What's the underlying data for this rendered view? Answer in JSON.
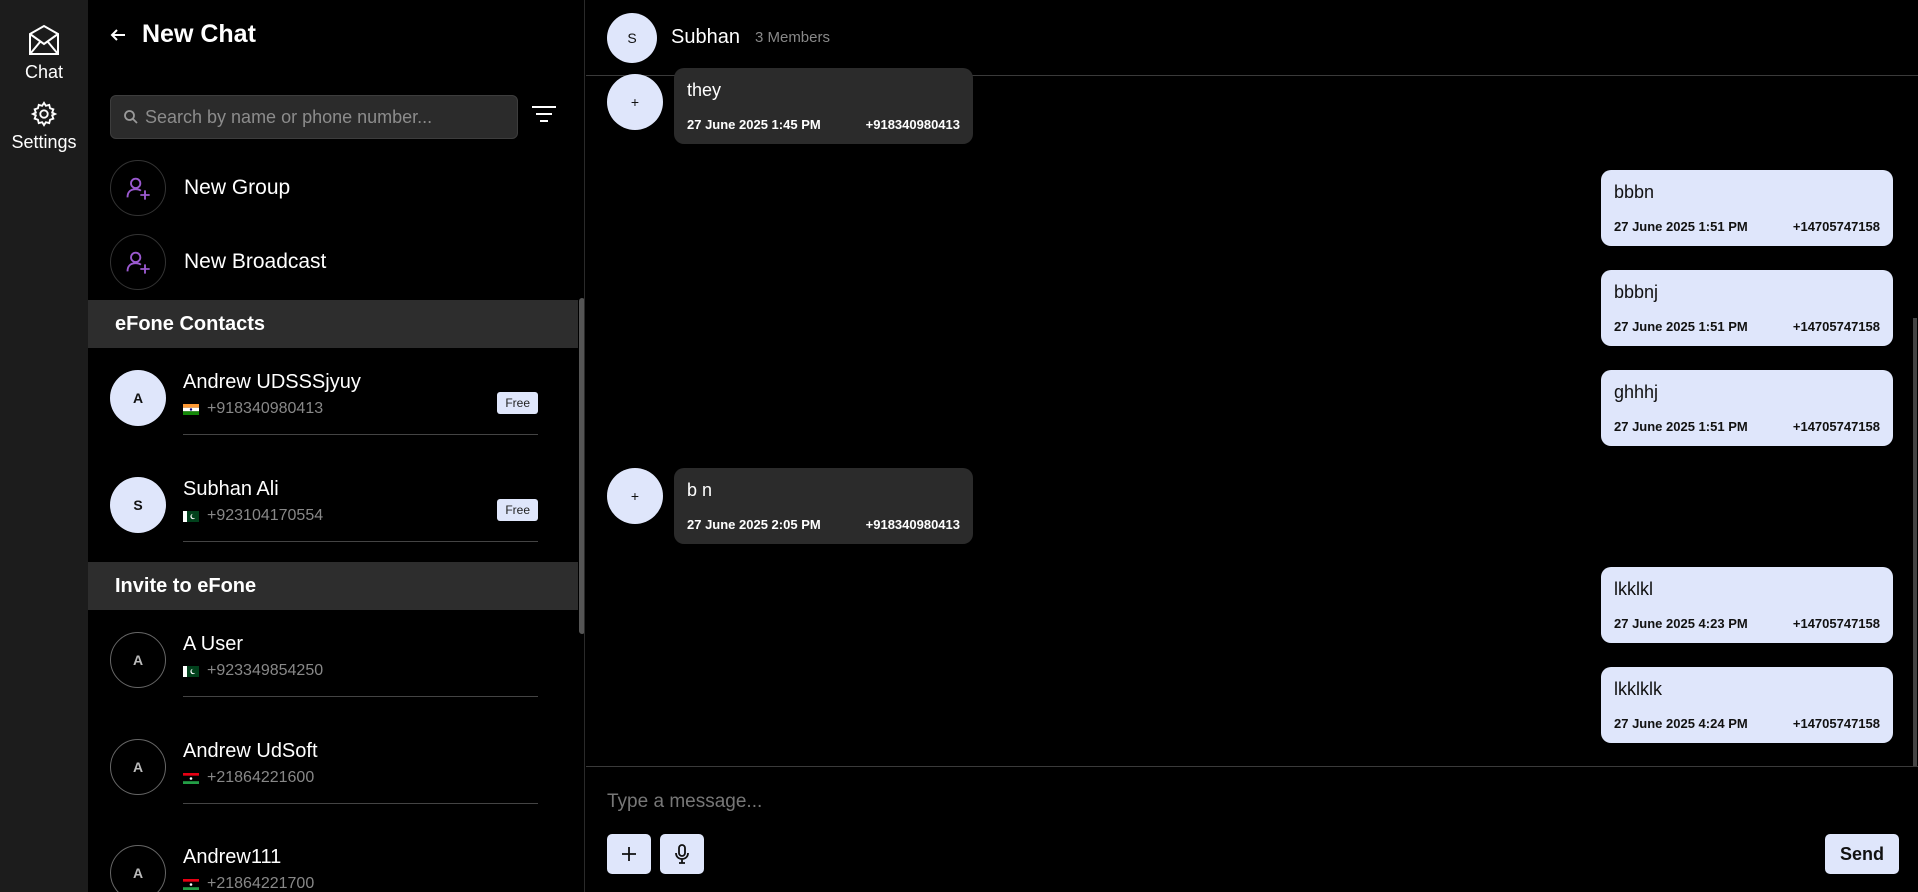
{
  "rail": {
    "chat_label": "Chat",
    "settings_label": "Settings"
  },
  "panel": {
    "title": "New Chat",
    "search_placeholder": "Search by name or phone number...",
    "actions": [
      {
        "label": "New Group",
        "icon": "add-user-icon"
      },
      {
        "label": "New Broadcast",
        "icon": "add-user-icon"
      }
    ],
    "efone_header": "eFone Contacts",
    "efone_contacts": [
      {
        "initial": "A",
        "name": "Andrew UDSSSjyuy",
        "phone": "+918340980413",
        "flag": "india",
        "badge": "Free"
      },
      {
        "initial": "S",
        "name": "Subhan Ali",
        "phone": "+923104170554",
        "flag": "pakistan",
        "badge": "Free"
      }
    ],
    "invite_header": "Invite to eFone",
    "invite_contacts": [
      {
        "initial": "A",
        "name": "A User",
        "phone": "+923349854250",
        "flag": "pakistan"
      },
      {
        "initial": "A",
        "name": "Andrew UdSoft",
        "phone": "+21864221600",
        "flag": "libya"
      },
      {
        "initial": "A",
        "name": "Andrew111",
        "phone": "+21864221700",
        "flag": "libya"
      }
    ]
  },
  "chat": {
    "initial": "S",
    "title": "Subhan",
    "members": "3 Members",
    "messages": [
      {
        "dir": "in",
        "avatar": "+",
        "text": "they",
        "time": "27 June 2025 1:45 PM",
        "sender": "+918340980413"
      },
      {
        "dir": "out",
        "text": "bbbn",
        "time": "27 June 2025 1:51 PM",
        "sender": "+14705747158"
      },
      {
        "dir": "out",
        "text": "bbbnj",
        "time": "27 June 2025 1:51 PM",
        "sender": "+14705747158"
      },
      {
        "dir": "out",
        "text": "ghhhj",
        "time": "27 June 2025 1:51 PM",
        "sender": "+14705747158"
      },
      {
        "dir": "in",
        "avatar": "+",
        "text": "b n",
        "time": "27 June 2025 2:05 PM",
        "sender": "+918340980413"
      },
      {
        "dir": "out",
        "text": "lkklkl",
        "time": "27 June 2025 4:23 PM",
        "sender": "+14705747158"
      },
      {
        "dir": "out",
        "text": "lkklklk",
        "time": "27 June 2025 4:24 PM",
        "sender": "+14705747158"
      }
    ],
    "composer_placeholder": "Type a message...",
    "send_label": "Send"
  },
  "colors": {
    "accent_light": "#dfe6fb",
    "icon_purple": "#9b59d0",
    "section_bg": "#2d2d2d"
  }
}
